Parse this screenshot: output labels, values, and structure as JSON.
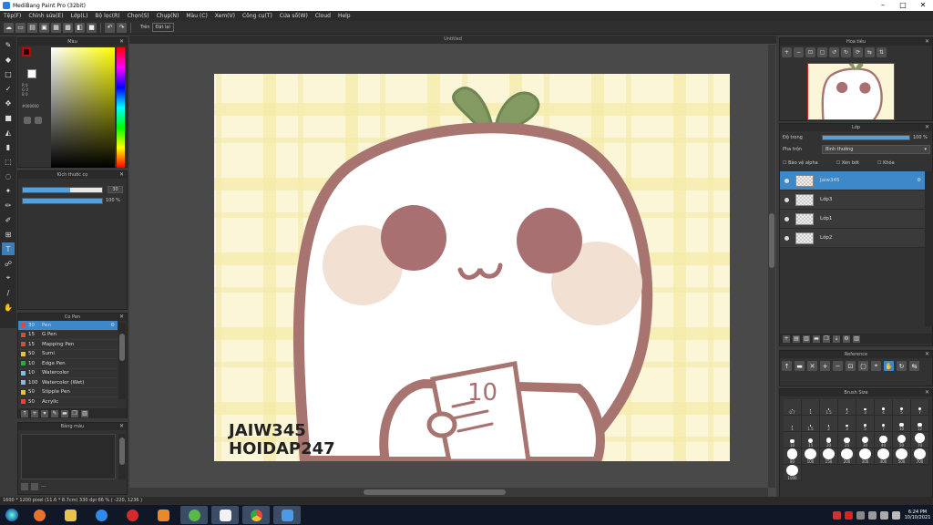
{
  "app": {
    "title": "MediBang Paint Pro (32bit)"
  },
  "window_controls": [
    "–",
    "□",
    "✕"
  ],
  "menu": [
    "Tệp(F)",
    "Chỉnh sửa(E)",
    "Lớp(L)",
    "Bộ lọc(R)",
    "Chọn(S)",
    "Chụp(N)",
    "Màu (C)",
    "Xem(V)",
    "Công cụ(T)",
    "Cửa sổ(W)",
    "Cloud",
    "Help"
  ],
  "toolbar": {
    "label": "Trên",
    "chip": "Đặt lại"
  },
  "color_panel": {
    "title": "Màu",
    "rgb": "R 0\nG 0\nB 0",
    "hex": "#000000"
  },
  "size_panel": {
    "title": "Kích thước cọ",
    "size_value": "30",
    "opacity_value": "100 %",
    "size_fraction": 0.6,
    "opacity_fraction": 1.0
  },
  "pen_panel": {
    "title": "Cọ Pen",
    "pens": [
      {
        "num": "30",
        "name": "Pen",
        "color": "#e8453c",
        "selected": true
      },
      {
        "num": "15",
        "name": "G Pen",
        "color": "#e8453c",
        "selected": false
      },
      {
        "num": "15",
        "name": "Mapping Pen",
        "color": "#e8453c",
        "selected": false
      },
      {
        "num": "50",
        "name": "Sumi",
        "color": "#e8c23c",
        "selected": false
      },
      {
        "num": "10",
        "name": "Edge Pen",
        "color": "#2fa84a",
        "selected": false
      },
      {
        "num": "10",
        "name": "Watercolor",
        "color": "#6ac8e8",
        "selected": false
      },
      {
        "num": "100",
        "name": "Watercolor (Wet)",
        "color": "#6ac8e8",
        "selected": false
      },
      {
        "num": "50",
        "name": "Stipple Pen",
        "color": "#e8c23c",
        "selected": false
      },
      {
        "num": "50",
        "name": "Acrylic",
        "color": "#e8453c",
        "selected": false
      }
    ]
  },
  "palette_panel": {
    "title": "Bảng màu",
    "footer": "---"
  },
  "document": {
    "tab": "Untitled",
    "watermark_line1": "JAIW345",
    "watermark_line2": "HOIDAP247"
  },
  "status": {
    "text": "1600 * 1200 pixel  (11.6 * 8.7cm)  330 dpi  66 %  ( -220, 1236 )"
  },
  "navigator": {
    "title": "Hoa tiêu"
  },
  "layer_panel": {
    "title": "Lớp",
    "opacity_label": "Độ trong",
    "opacity_value": "100 %",
    "opacity_fraction": 1.0,
    "blend_label": "Pha trộn",
    "blend_value": "Bình thường",
    "opt_alpha": "Bảo vệ alpha",
    "opt_clip": "Xén bớt",
    "opt_lock": "Khóa",
    "layers": [
      {
        "name": "Jaiw345",
        "selected": true
      },
      {
        "name": "Lớp3",
        "selected": false
      },
      {
        "name": "Lớp1",
        "selected": false
      },
      {
        "name": "Lớp2",
        "selected": false
      }
    ]
  },
  "reference_panel": {
    "title": "Reference"
  },
  "brush_panel": {
    "title": "Brush Size",
    "sizes": [
      "0.7",
      "1",
      "1.5",
      "2",
      "3",
      "4",
      "5",
      "7",
      "1",
      "1.5",
      "2",
      "3",
      "5",
      "7",
      "10",
      "12",
      "10",
      "15",
      "20",
      "25",
      "30",
      "40",
      "50",
      "70",
      "80",
      "100",
      "150",
      "200",
      "300",
      "400",
      "500",
      "700",
      "1000"
    ]
  },
  "taskbar": {
    "time": "6:24 PM",
    "date": "10/10/2021"
  }
}
